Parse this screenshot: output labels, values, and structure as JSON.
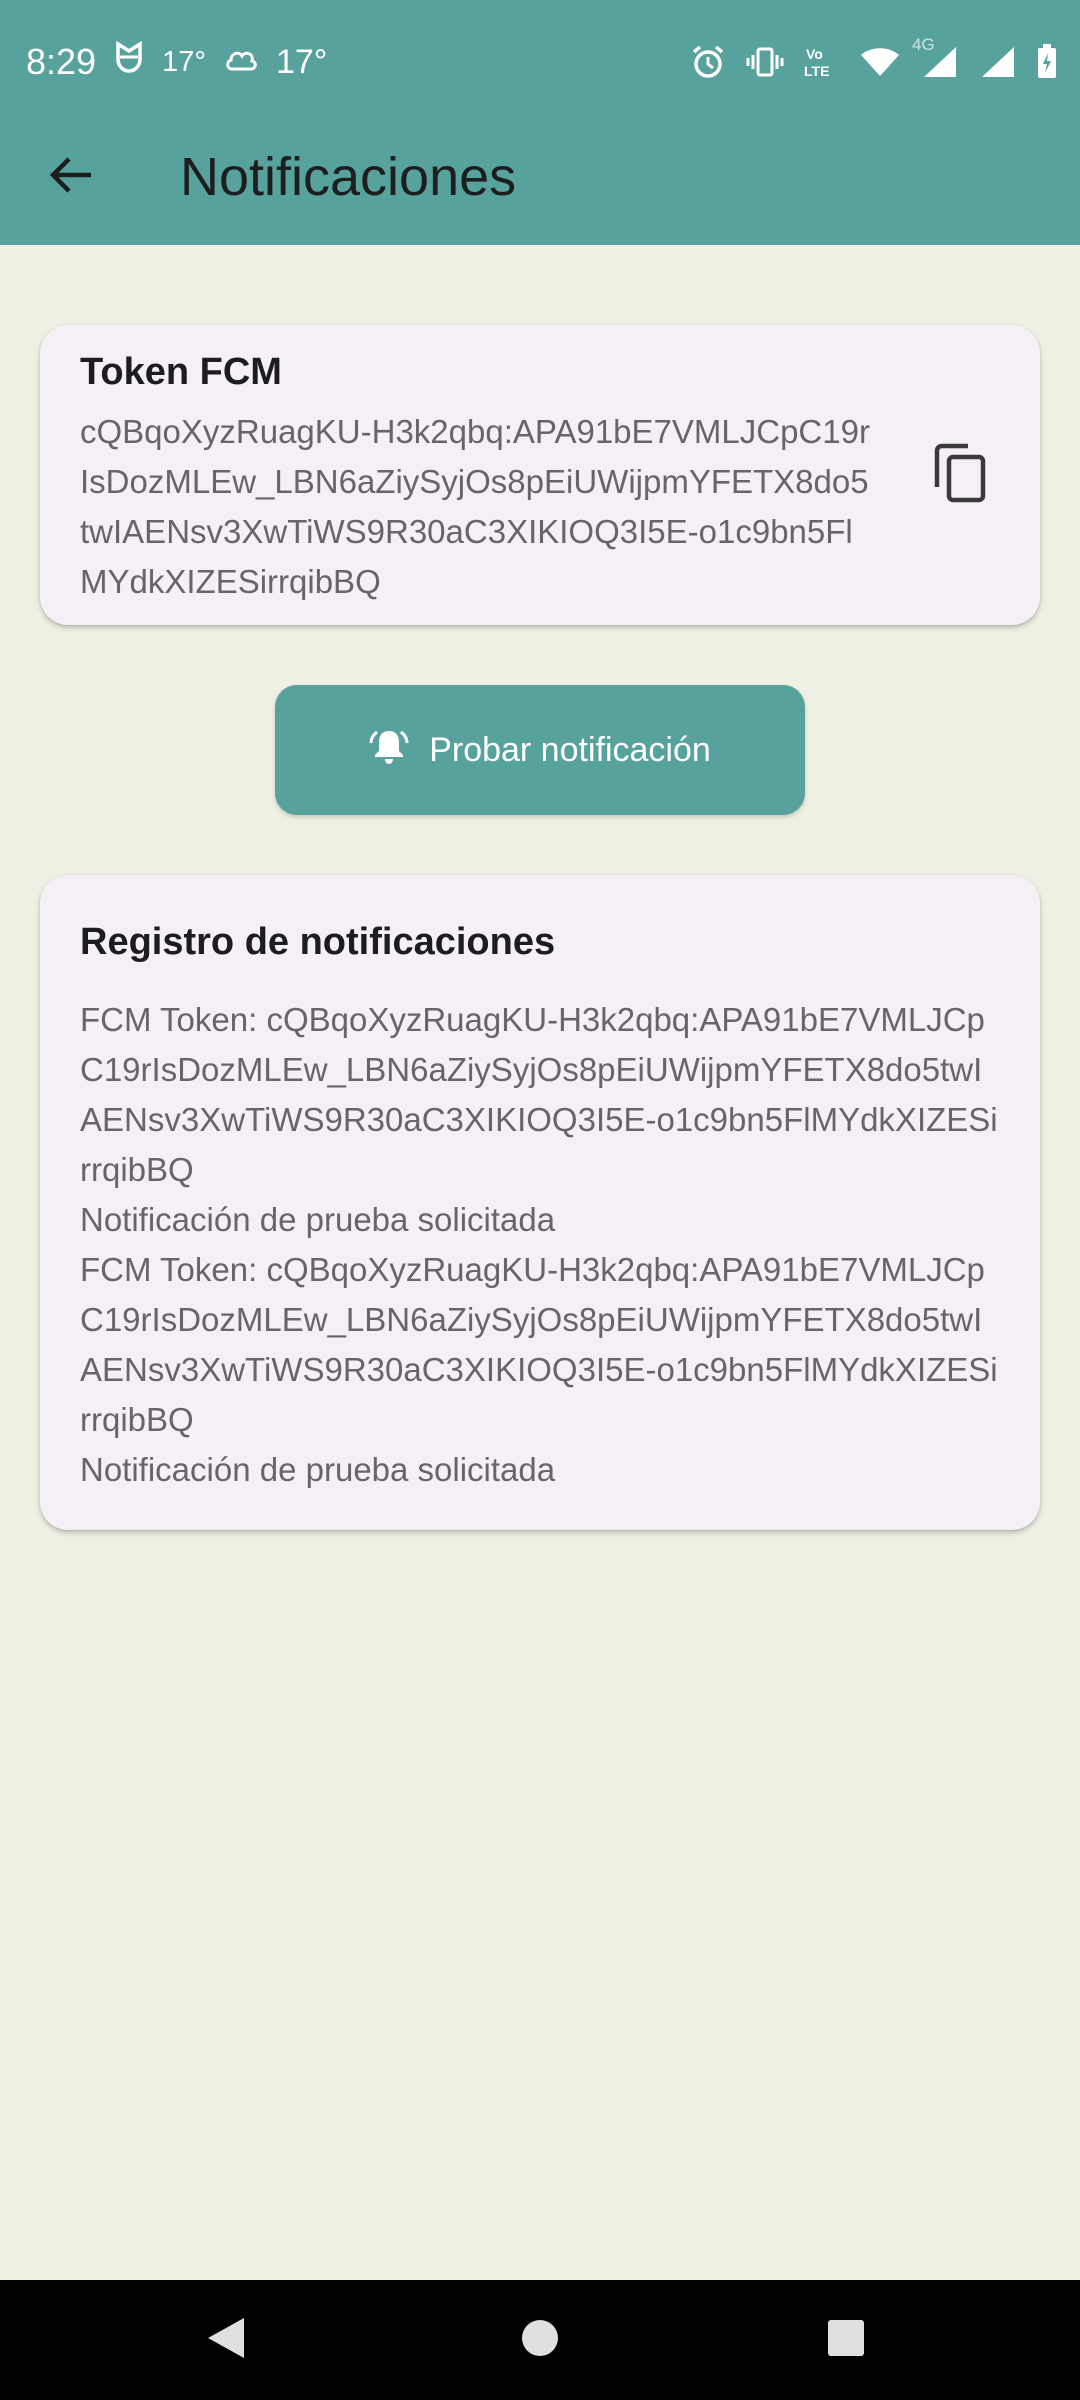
{
  "status_bar": {
    "time": "8:29",
    "temp1": "17°",
    "temp2": "17°",
    "network_label": "4G",
    "icons": [
      "tulip-icon",
      "cloud-icon",
      "alarm-icon",
      "vibrate-icon",
      "volte-icon",
      "wifi-icon",
      "signal-icon",
      "signal-icon",
      "battery-icon"
    ]
  },
  "app_bar": {
    "title": "Notificaciones",
    "back_icon": "arrow-back-icon"
  },
  "token_card": {
    "title": "Token FCM",
    "token": "cQBqoXyzRuagKU-H3k2qbq:APA91bE7VMLJCpC19rIsDozMLEw_LBN6aZiySyjOs8pEiUWijpmYFETX8do5twIAENsv3XwTiWS9R30aC3XIKIOQ3I5E-o1c9bn5FlMYdkXIZESirrqibBQ",
    "copy_icon": "copy-icon"
  },
  "test_button": {
    "label": "Probar notificación",
    "icon": "bell-ring-icon"
  },
  "log_card": {
    "title": "Registro de notificaciones",
    "entries": [
      "FCM Token: cQBqoXyzRuagKU-H3k2qbq:APA91bE7VMLJCpC19rIsDozMLEw_LBN6aZiySyjOs8pEiUWijpmYFETX8do5twIAENsv3XwTiWS9R30aC3XIKIOQ3I5E-o1c9bn5FlMYdkXIZESirrqibBQ",
      "Notificación de prueba solicitada",
      "FCM Token: cQBqoXyzRuagKU-H3k2qbq:APA91bE7VMLJCpC19rIsDozMLEw_LBN6aZiySyjOs8pEiUWijpmYFETX8do5twIAENsv3XwTiWS9R30aC3XIKIOQ3I5E-o1c9bn5FlMYdkXIZESirrqibBQ",
      "Notificación de prueba solicitada"
    ]
  },
  "colors": {
    "primary": "#58a29d",
    "background": "#eff0e4",
    "card": "#f4f0f6",
    "text_secondary": "#68646b"
  }
}
